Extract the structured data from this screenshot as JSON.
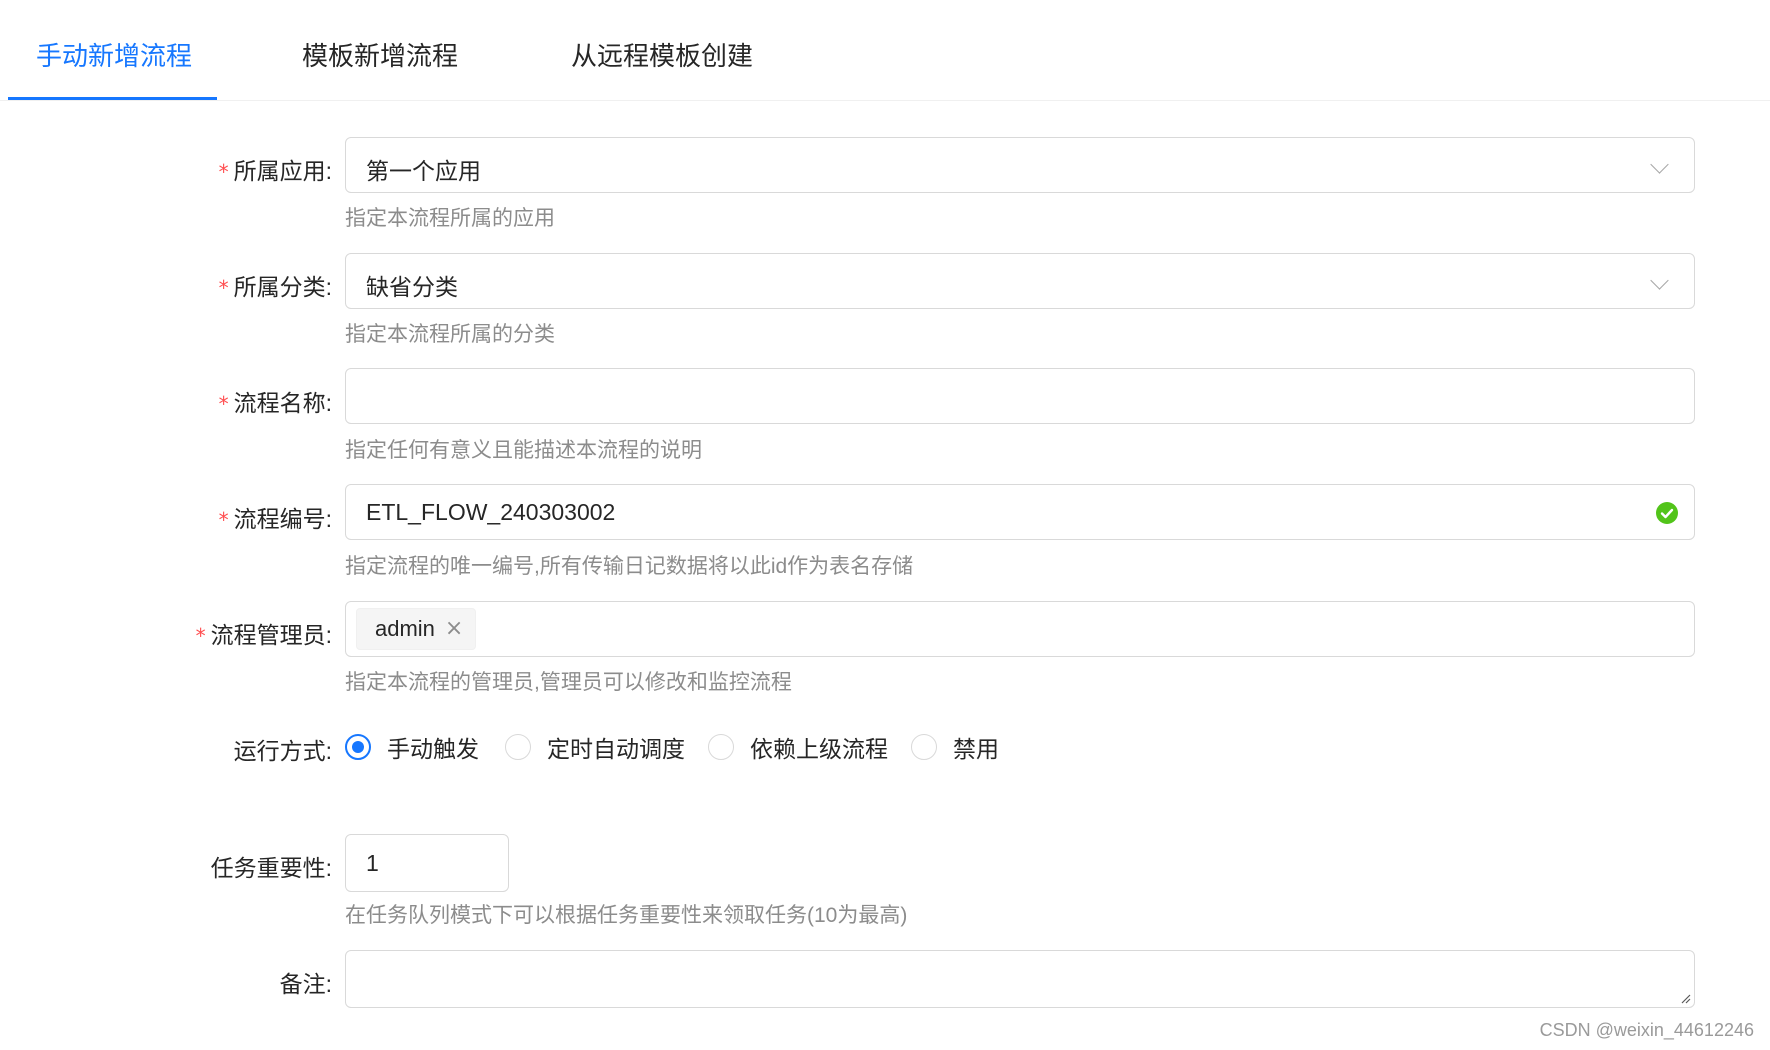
{
  "tabs": [
    {
      "label": "手动新增流程",
      "active": true
    },
    {
      "label": "模板新增流程",
      "active": false
    },
    {
      "label": "从远程模板创建",
      "active": false
    }
  ],
  "form": {
    "required_mark": "*",
    "app": {
      "label": "所属应用:",
      "value": "第一个应用",
      "hint": "指定本流程所属的应用"
    },
    "category": {
      "label": "所属分类:",
      "value": "缺省分类",
      "hint": "指定本流程所属的分类"
    },
    "flow_name": {
      "label": "流程名称:",
      "value": "",
      "hint": "指定任何有意义且能描述本流程的说明"
    },
    "flow_code": {
      "label": "流程编号:",
      "value": "ETL_FLOW_240303002",
      "hint": "指定流程的唯一编号,所有传输日记数据将以此id作为表名存储",
      "status_icon": "check-circle-icon"
    },
    "managers": {
      "label": "流程管理员:",
      "tags": [
        "admin"
      ],
      "tag_close": "×",
      "hint": "指定本流程的管理员,管理员可以修改和监控流程"
    },
    "run_mode": {
      "label": "运行方式:",
      "options": [
        "手动触发",
        "定时自动调度",
        "依赖上级流程",
        "禁用"
      ],
      "selected": "手动触发"
    },
    "importance": {
      "label": "任务重要性:",
      "value": "1",
      "hint": "在任务队列模式下可以根据任务重要性来领取任务(10为最高)"
    },
    "remark": {
      "label": "备注:",
      "value": ""
    }
  },
  "colors": {
    "accent": "#1677ff",
    "required": "#ff4d4f",
    "success": "#52c41a",
    "hint": "#8c8c8c"
  },
  "watermark": "CSDN @weixin_44612246"
}
